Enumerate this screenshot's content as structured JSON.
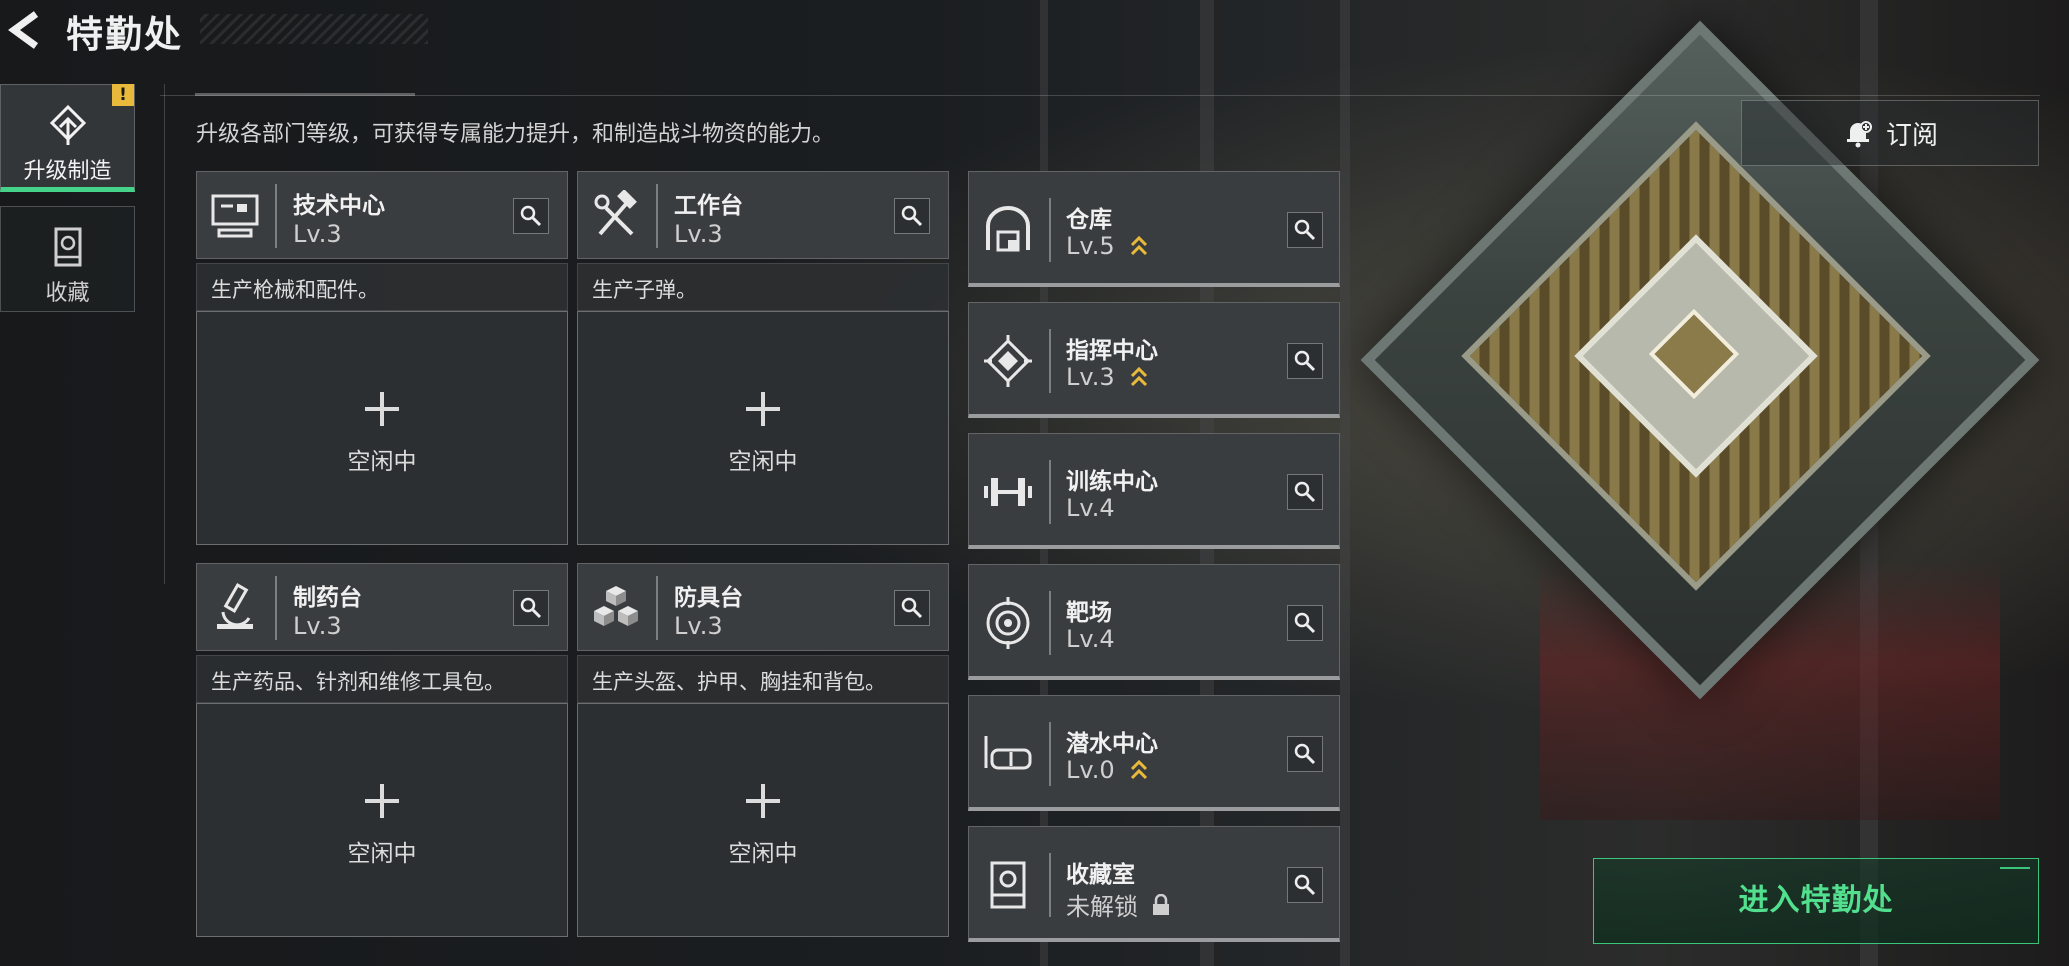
{
  "header": {
    "title": "特勤处"
  },
  "sidebar": {
    "tabs": [
      {
        "label": "升级制造",
        "icon": "upgrade-icon",
        "active": true,
        "alert": "!"
      },
      {
        "label": "收藏",
        "icon": "collection-icon",
        "active": false
      }
    ]
  },
  "intro": "升级各部门等级，可获得专属能力提升，和制造战斗物资的能力。",
  "subscribe_label": "订阅",
  "stations": [
    {
      "name": "技术中心",
      "level": "Lv.3",
      "desc": "生产枪械和配件。",
      "status": "空闲中",
      "icon": "computer-icon"
    },
    {
      "name": "工作台",
      "level": "Lv.3",
      "desc": "生产子弹。",
      "status": "空闲中",
      "icon": "hammer-wrench-icon"
    },
    {
      "name": "制药台",
      "level": "Lv.3",
      "desc": "生产药品、针剂和维修工具包。",
      "status": "空闲中",
      "icon": "microscope-icon"
    },
    {
      "name": "防具台",
      "level": "Lv.3",
      "desc": "生产头盔、护甲、胸挂和背包。",
      "status": "空闲中",
      "icon": "cubes-icon"
    }
  ],
  "facilities": [
    {
      "name": "仓库",
      "level": "Lv.5",
      "upgradable": true,
      "icon": "warehouse-icon"
    },
    {
      "name": "指挥中心",
      "level": "Lv.3",
      "upgradable": true,
      "icon": "chip-icon"
    },
    {
      "name": "训练中心",
      "level": "Lv.4",
      "upgradable": false,
      "icon": "dumbbell-icon"
    },
    {
      "name": "靶场",
      "level": "Lv.4",
      "upgradable": false,
      "icon": "target-icon"
    },
    {
      "name": "潜水中心",
      "level": "Lv.0",
      "upgradable": true,
      "icon": "diving-mask-icon"
    },
    {
      "name": "收藏室",
      "level": "未解锁",
      "upgradable": false,
      "locked": true,
      "icon": "display-case-icon"
    }
  ],
  "enter_button": "进入特勤处",
  "colors": {
    "accent": "#45d38a",
    "upgrade": "#e8b93a",
    "panel": "#3a3d3f"
  }
}
